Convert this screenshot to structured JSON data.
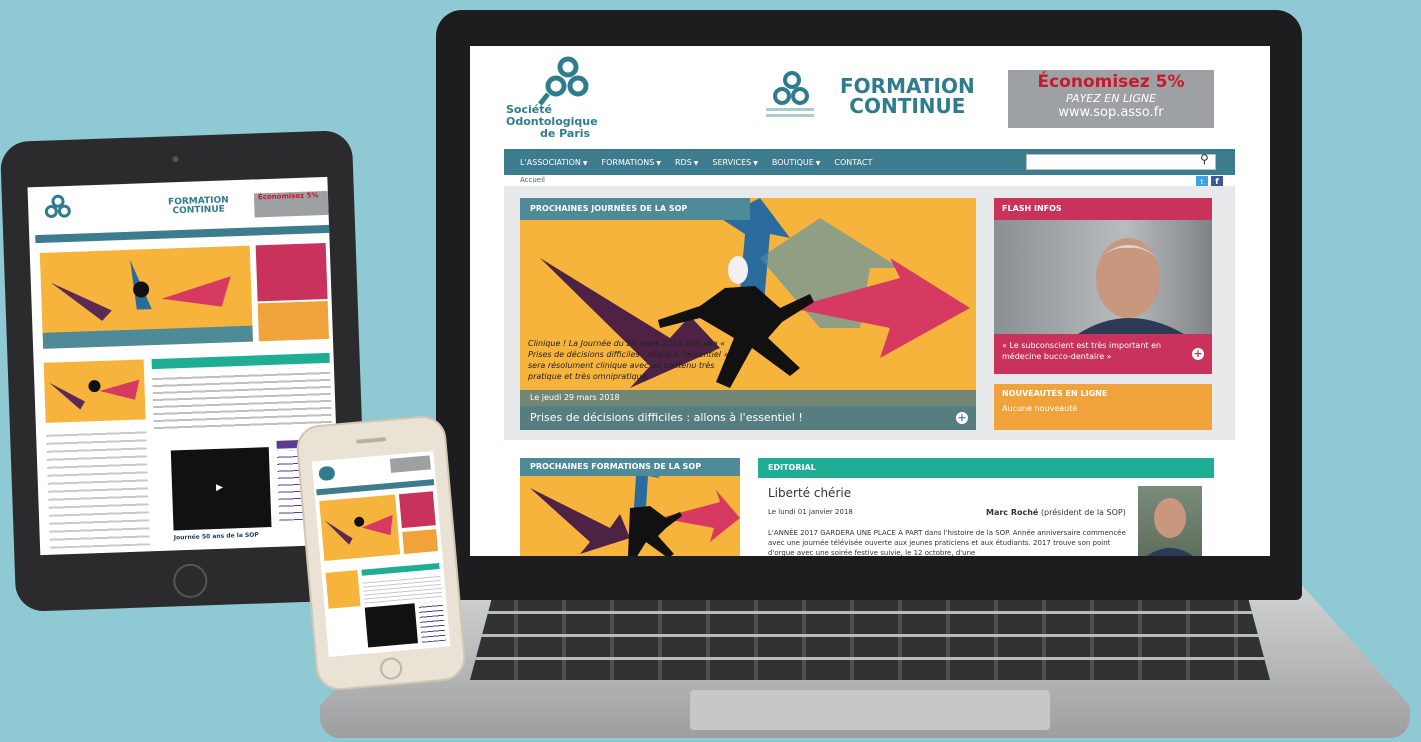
{
  "logo": {
    "line1": "Société",
    "line2": "Odontologique",
    "line3": "de Paris"
  },
  "formation": {
    "line1": "FORMATION",
    "line2": "CONTINUE"
  },
  "promo": {
    "line1": "Économisez 5%",
    "line2": "PAYEZ EN LIGNE",
    "line3": "www.sop.asso.fr"
  },
  "nav": {
    "items": [
      {
        "label": "L'ASSOCIATION"
      },
      {
        "label": "FORMATIONS"
      },
      {
        "label": "RDS"
      },
      {
        "label": "SERVICES"
      },
      {
        "label": "BOUTIQUE"
      },
      {
        "label": "CONTACT"
      }
    ],
    "search_placeholder": ""
  },
  "breadcrumb": "Accueil",
  "hero": {
    "label": "PROCHAINES JOURNÉES DE LA SOP",
    "excerpt": "Clinique ! La Journée du 29 mars 2018 intitulée « Prises de décisions difficiles : allons à l'essentiel » sera résolument clinique avec un contenu très pratique et très omnipratique.",
    "date": "Le jeudi 29 mars 2018",
    "title": "Prises de décisions difficiles : allons à l'essentiel !"
  },
  "flash": {
    "label": "FLASH INFOS",
    "text": "« Le subconscient est très important en médecine bucco-dentaire »"
  },
  "news": {
    "label": "NOUVEAUTÉS EN LIGNE",
    "text": "Aucune nouveauté"
  },
  "prochaines": {
    "label": "PROCHAINES FORMATIONS DE LA SOP"
  },
  "editorial": {
    "label": "EDITORIAL",
    "title": "Liberté chérie",
    "date": "Le lundi 01 janvier 2018",
    "author_name": "Marc Roché",
    "author_role": "(président de la SOP)",
    "body": "L'ANNÉE 2017 GARDERA UNE PLACE À PART dans l'histoire de la SOP. Année anniversaire commencée avec une journée télévisée ouverte aux jeunes praticiens et aux étudiants. 2017 trouve son point d'orgue avec une soirée festive suivie, le 12 octobre, d'une"
  },
  "tablet": {
    "video_title": "Journée 50 ans de la SOP"
  },
  "colors": {
    "background": "#8fc9d3",
    "nav": "#3d7b8e",
    "flash": "#c9325a",
    "news": "#f0a33a",
    "editorial": "#1fae93",
    "hero": "#f7b43c"
  }
}
